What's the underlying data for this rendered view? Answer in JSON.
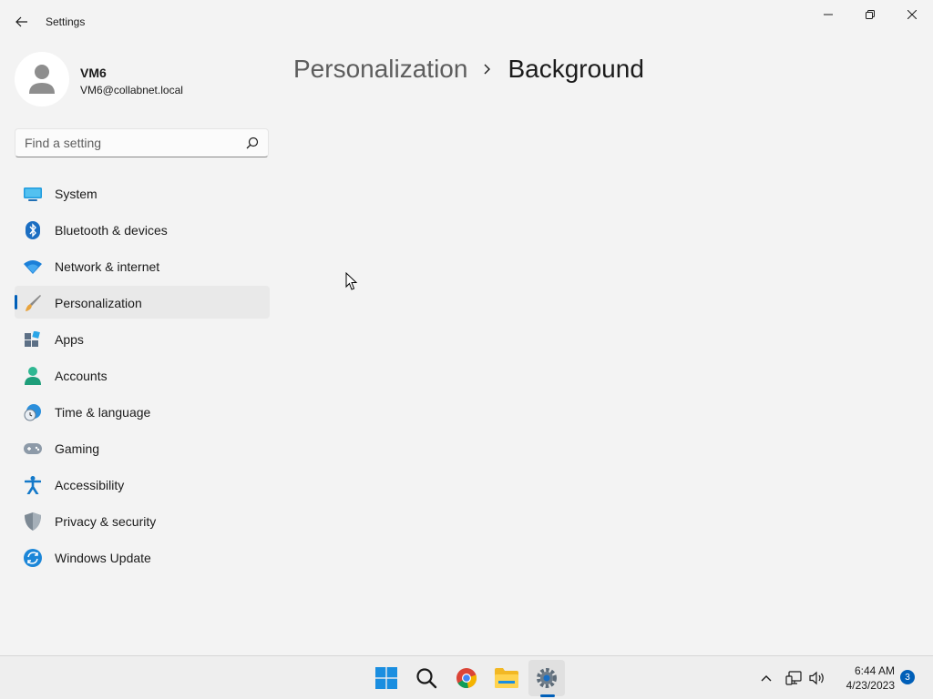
{
  "window": {
    "title": "Settings"
  },
  "profile": {
    "name": "VM6",
    "email": "VM6@collabnet.local"
  },
  "search": {
    "placeholder": "Find a setting",
    "value": ""
  },
  "nav": {
    "items": [
      {
        "label": "System",
        "icon": "system-icon"
      },
      {
        "label": "Bluetooth & devices",
        "icon": "bluetooth-icon"
      },
      {
        "label": "Network & internet",
        "icon": "wifi-icon"
      },
      {
        "label": "Personalization",
        "icon": "brush-icon",
        "selected": true
      },
      {
        "label": "Apps",
        "icon": "apps-icon"
      },
      {
        "label": "Accounts",
        "icon": "accounts-icon"
      },
      {
        "label": "Time & language",
        "icon": "clock-globe-icon"
      },
      {
        "label": "Gaming",
        "icon": "gamepad-icon"
      },
      {
        "label": "Accessibility",
        "icon": "accessibility-icon"
      },
      {
        "label": "Privacy & security",
        "icon": "shield-icon"
      },
      {
        "label": "Windows Update",
        "icon": "update-icon"
      }
    ]
  },
  "breadcrumb": {
    "parent": "Personalization",
    "current": "Background"
  },
  "taskbar": {
    "time": "6:44 AM",
    "date": "4/23/2023",
    "notification_count": "3"
  },
  "colors": {
    "accent": "#005fb8",
    "background": "#f3f3f3",
    "selected": "#e9e9e9"
  }
}
